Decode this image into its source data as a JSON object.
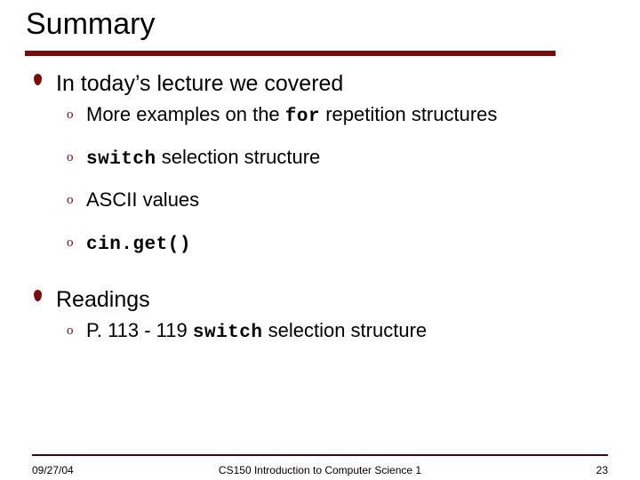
{
  "slide": {
    "title": "Summary",
    "accent_color": "#7A0B0B",
    "footer_rule_color": "#3B0A0A",
    "bullet_icon": "droplet-bullet",
    "sub_bullet_icon": "circle-o-bullet",
    "sections": [
      {
        "heading": "In today’s lecture we covered",
        "items": [
          {
            "parts": [
              {
                "text": "More examples on the ",
                "style": "normal"
              },
              {
                "text": "for",
                "style": "mono"
              },
              {
                "text": " repetition structures",
                "style": "normal"
              }
            ]
          },
          {
            "parts": [
              {
                "text": "switch",
                "style": "mono"
              },
              {
                "text": " selection structure",
                "style": "normal"
              }
            ]
          },
          {
            "parts": [
              {
                "text": "ASCII values",
                "style": "normal"
              }
            ]
          },
          {
            "parts": [
              {
                "text": "cin.get()",
                "style": "mono"
              }
            ]
          }
        ]
      },
      {
        "heading": "Readings",
        "items": [
          {
            "parts": [
              {
                "text": "P. 113 - 119 ",
                "style": "normal"
              },
              {
                "text": "switch",
                "style": "mono"
              },
              {
                "text": " selection structure",
                "style": "normal"
              }
            ]
          }
        ]
      }
    ]
  },
  "footer": {
    "date": "09/27/04",
    "course": "CS150 Introduction to Computer Science 1",
    "page_number": "23"
  }
}
